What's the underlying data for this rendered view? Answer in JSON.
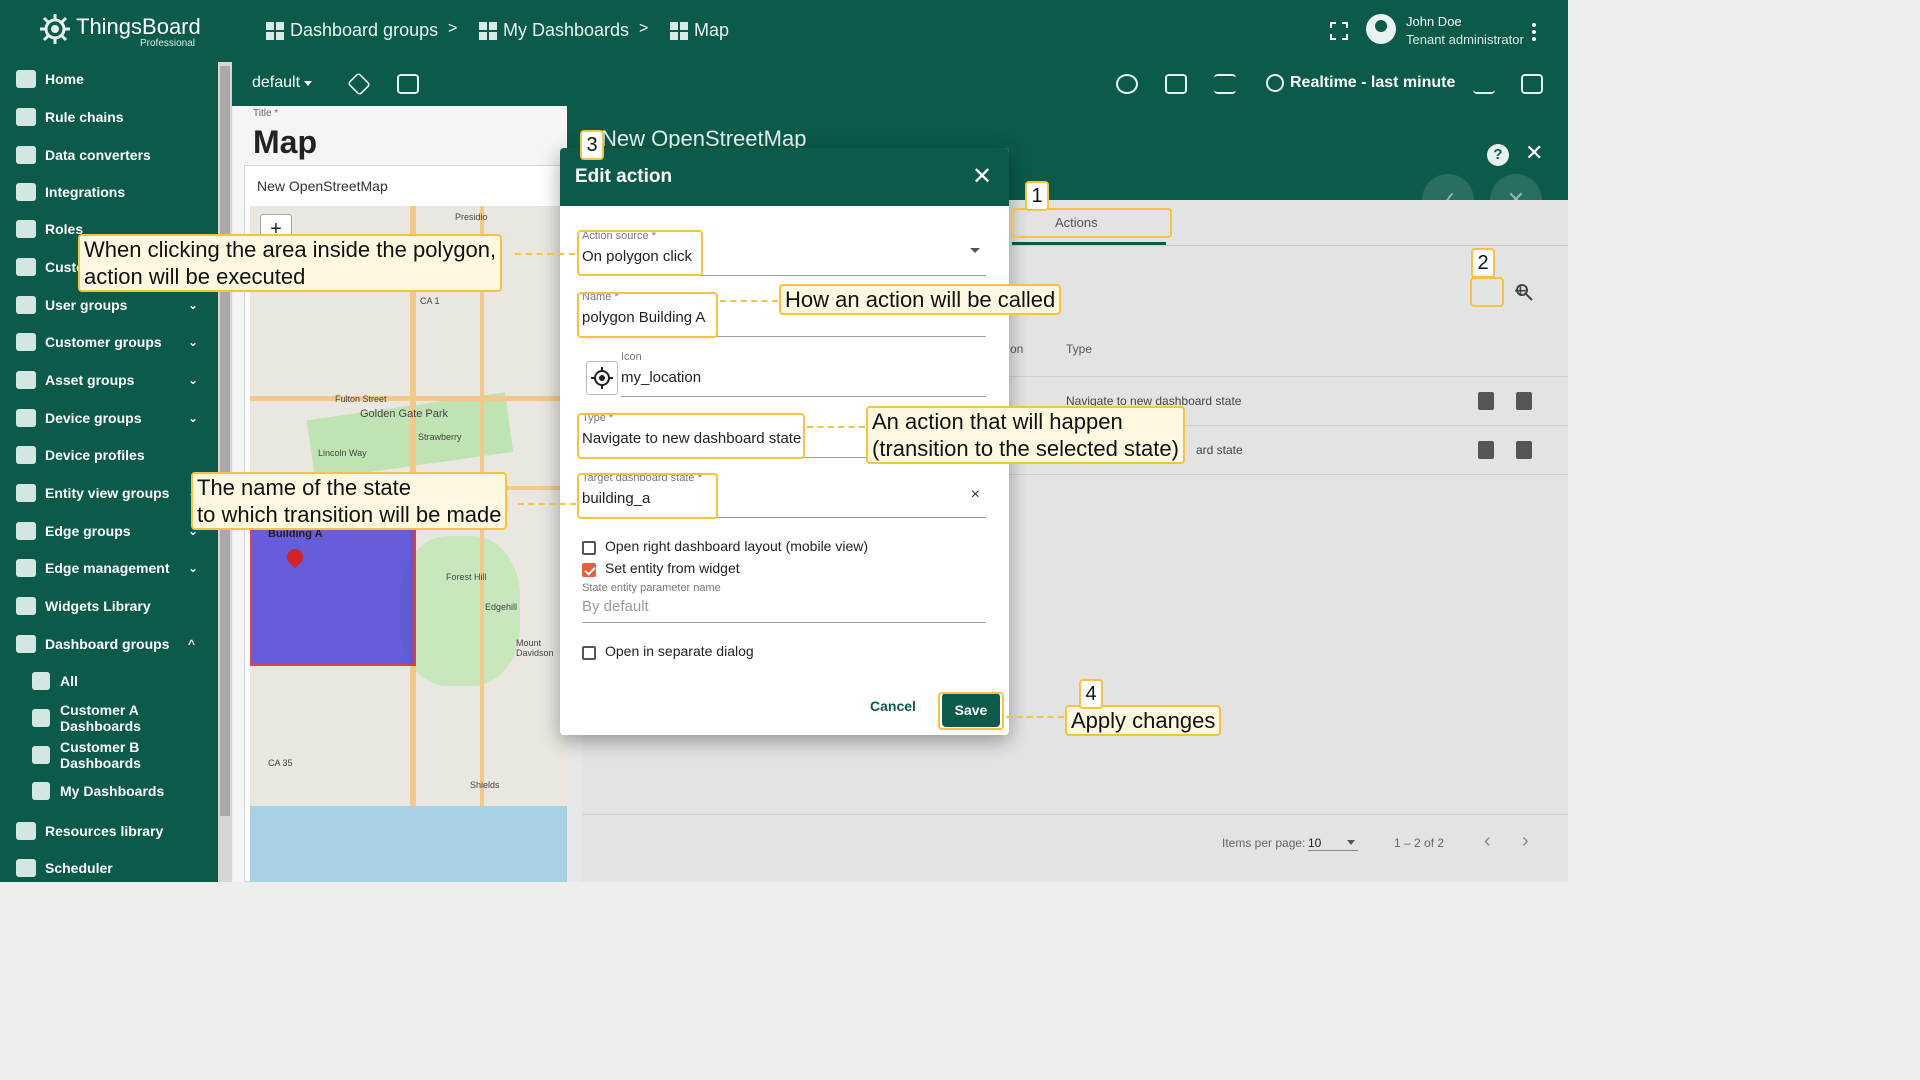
{
  "header": {
    "logo_name": "ThingsBoard",
    "logo_edition": "Professional",
    "breadcrumbs": [
      "Dashboard groups",
      "My Dashboards",
      "Map"
    ],
    "separator": ">",
    "user_name": "John Doe",
    "user_role": "Tenant administrator"
  },
  "sidebar": {
    "items": [
      {
        "label": "Home"
      },
      {
        "label": "Rule chains"
      },
      {
        "label": "Data converters"
      },
      {
        "label": "Integrations"
      },
      {
        "label": "Roles"
      },
      {
        "label": "Custo"
      },
      {
        "label": "User groups",
        "chevron": "⌄"
      },
      {
        "label": "Customer groups",
        "chevron": "⌄"
      },
      {
        "label": "Asset groups",
        "chevron": "⌄"
      },
      {
        "label": "Device groups",
        "chevron": "⌄"
      },
      {
        "label": "Device profiles"
      },
      {
        "label": "Entity view groups",
        "chevron": "⌄"
      },
      {
        "label": "Edge groups",
        "chevron": "⌄"
      },
      {
        "label": "Edge management",
        "chevron": "⌄"
      },
      {
        "label": "Widgets Library"
      },
      {
        "label": "Dashboard groups",
        "chevron": "^"
      },
      {
        "label": "All"
      },
      {
        "label": "Customer A Dashboards"
      },
      {
        "label": "Customer B Dashboards"
      },
      {
        "label": "My Dashboards"
      },
      {
        "label": "Resources library"
      },
      {
        "label": "Scheduler"
      }
    ]
  },
  "dashboard_toolbar": {
    "state": "default",
    "timewindow": "Realtime - last minute"
  },
  "widget": {
    "title_label": "Title *",
    "title_value": "Map",
    "widget_title": "New OpenStreetMap",
    "map_labels": {
      "polygon": "Building A",
      "presidio": "Presidio",
      "ca1": "CA 1",
      "ca35": "CA 35",
      "golden_gate": "Golden Gate Park",
      "fulton": "Fulton Street",
      "lincoln": "Lincoln Way",
      "forest_hill": "Forest Hill",
      "edgehill": "Edgehill",
      "mount_davidson": "Mount Davidson",
      "strawberry": "Strawberry",
      "shields": "Shields"
    }
  },
  "editor": {
    "title": "New OpenStreetMap",
    "tab_actions": "Actions",
    "columns": {
      "name": "on",
      "type": "Type"
    },
    "rows": [
      {
        "type": "Navigate to new dashboard state"
      },
      {
        "type": "ard state"
      }
    ],
    "pager": {
      "items_per_page_label": "Items per page:",
      "items_per_page": "10",
      "range": "1 – 2 of 2"
    }
  },
  "modal": {
    "title": "Edit action",
    "action_source_label": "Action source *",
    "action_source_value": "On polygon click",
    "name_label": "Name *",
    "name_value": "polygon Building A",
    "icon_label": "Icon",
    "icon_value": "my_location",
    "type_label": "Type *",
    "type_value": "Navigate to new dashboard state",
    "target_state_label": "Target dashboard state *",
    "target_state_value": "building_a",
    "chk_open_right": "Open right dashboard layout (mobile view)",
    "chk_set_entity": "Set entity from widget",
    "state_param_label": "State entity parameter name",
    "state_param_placeholder": "By default",
    "chk_separate_dialog": "Open in separate dialog",
    "cancel": "Cancel",
    "save": "Save"
  },
  "annotations": {
    "polygon_click": [
      "When clicking the area inside the polygon,",
      "action will be executed"
    ],
    "name_call": "How an action will be called",
    "action_happen": [
      "An action that will happen",
      "(transition to the selected state)"
    ],
    "state_name": [
      "The name of the state",
      "to which transition will be made"
    ],
    "apply": "Apply changes",
    "n1": "1",
    "n2": "2",
    "n3": "3",
    "n4": "4"
  },
  "colors": {
    "primary": "#0b5a4a",
    "accent_checkbox": "#e65f3d",
    "callout_border": "#f5c242",
    "callout_bg": "#fff8e1",
    "polygon_fill": "#4e45d8"
  }
}
